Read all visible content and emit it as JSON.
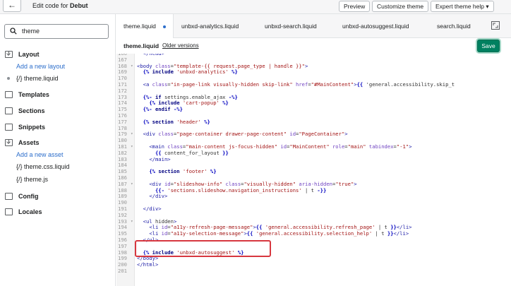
{
  "topbar": {
    "back_symbol": "←",
    "title_prefix": "Edit code for",
    "theme_name": "Debut",
    "preview_label": "Preview",
    "customize_label": "Customize theme",
    "expert_label": "Expert theme help ▾"
  },
  "sidebar": {
    "search_value": "theme",
    "layout_label": "Layout",
    "add_layout": "Add a new layout",
    "layout_file": "theme.liquid",
    "templates_label": "Templates",
    "sections_label": "Sections",
    "snippets_label": "Snippets",
    "assets_label": "Assets",
    "add_asset": "Add a new asset",
    "asset_file_1": "theme.css.liquid",
    "asset_file_2": "theme.js",
    "config_label": "Config",
    "locales_label": "Locales",
    "file_tag": "{/}"
  },
  "tabs": [
    "theme.liquid",
    "unbxd-analytics.liquid",
    "unbxd-search.liquid",
    "unbxd-autosuggest.liquid",
    "search.liquid"
  ],
  "filebar": {
    "file_name": "theme.liquid",
    "older_versions": "Older versions",
    "save_label": "Save"
  },
  "code_lines": [
    {
      "n": "166",
      "f": "",
      "t": "  </head>"
    },
    {
      "n": "167",
      "f": "",
      "t": ""
    },
    {
      "n": "168",
      "f": "▾",
      "t": "<body class=\"template-{{ request.page_type | handle }}\">"
    },
    {
      "n": "169",
      "f": "",
      "t": "  {% include 'unbxd-analytics' %}"
    },
    {
      "n": "170",
      "f": "",
      "t": ""
    },
    {
      "n": "171",
      "f": "",
      "t": "  <a class=\"in-page-link visually-hidden skip-link\" href=\"#MainContent\">{{ 'general.accessibility.skip_t"
    },
    {
      "n": "172",
      "f": "",
      "t": ""
    },
    {
      "n": "173",
      "f": "",
      "t": "  {%- if settings.enable_ajax -%}"
    },
    {
      "n": "174",
      "f": "",
      "t": "    {% include 'cart-popup' %}"
    },
    {
      "n": "175",
      "f": "",
      "t": "  {%- endif -%}"
    },
    {
      "n": "176",
      "f": "",
      "t": ""
    },
    {
      "n": "177",
      "f": "",
      "t": "  {% section 'header' %}"
    },
    {
      "n": "178",
      "f": "",
      "t": ""
    },
    {
      "n": "179",
      "f": "▾",
      "t": "  <div class=\"page-container drawer-page-content\" id=\"PageContainer\">"
    },
    {
      "n": "180",
      "f": "",
      "t": ""
    },
    {
      "n": "181",
      "f": "▾",
      "t": "    <main class=\"main-content js-focus-hidden\" id=\"MainContent\" role=\"main\" tabindex=\"-1\">"
    },
    {
      "n": "182",
      "f": "",
      "t": "      {{ content_for_layout }}"
    },
    {
      "n": "183",
      "f": "",
      "t": "    </main>"
    },
    {
      "n": "184",
      "f": "",
      "t": ""
    },
    {
      "n": "185",
      "f": "",
      "t": "    {% section 'footer' %}"
    },
    {
      "n": "186",
      "f": "",
      "t": ""
    },
    {
      "n": "187",
      "f": "▾",
      "t": "    <div id=\"slideshow-info\" class=\"visually-hidden\" aria-hidden=\"true\">"
    },
    {
      "n": "188",
      "f": "",
      "t": "      {{- 'sections.slideshow.navigation_instructions' | t -}}"
    },
    {
      "n": "189",
      "f": "",
      "t": "    </div>"
    },
    {
      "n": "190",
      "f": "",
      "t": ""
    },
    {
      "n": "191",
      "f": "",
      "t": "  </div>"
    },
    {
      "n": "192",
      "f": "",
      "t": ""
    },
    {
      "n": "193",
      "f": "▾",
      "t": "  <ul hidden>"
    },
    {
      "n": "194",
      "f": "",
      "t": "    <li id=\"a11y-refresh-page-message\">{{ 'general.accessibility.refresh_page' | t }}</li>"
    },
    {
      "n": "195",
      "f": "",
      "t": "    <li id=\"a11y-selection-message\">{{ 'general.accessibility.selection_help' | t }}</li>"
    },
    {
      "n": "196",
      "f": "",
      "t": "  </ul>"
    },
    {
      "n": "197",
      "f": "",
      "t": ""
    },
    {
      "n": "198",
      "f": "",
      "t": "  {% include 'unbxd-autosuggest' %}"
    },
    {
      "n": "199",
      "f": "",
      "t": "</body>"
    },
    {
      "n": "200",
      "f": "",
      "t": "</html>"
    },
    {
      "n": "201",
      "f": "",
      "t": ""
    }
  ],
  "colors": {
    "save_green": "#008060",
    "link_blue": "#2c6ecb",
    "highlight_red": "#d7373f"
  }
}
